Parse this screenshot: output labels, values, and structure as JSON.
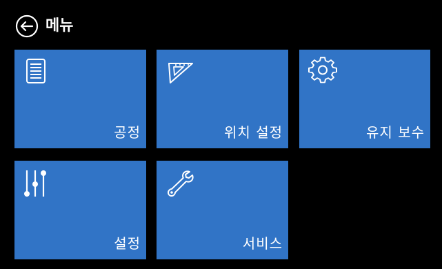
{
  "header": {
    "title": "메뉴",
    "back_icon": "back-arrow-circle-icon"
  },
  "tiles": [
    {
      "label": "공정",
      "icon": "list-document-icon"
    },
    {
      "label": "위치 설정",
      "icon": "set-square-ruler-icon"
    },
    {
      "label": "유지 보수",
      "icon": "gear-icon"
    },
    {
      "label": "설정",
      "icon": "sliders-icon"
    },
    {
      "label": "서비스",
      "icon": "wrench-icon"
    }
  ],
  "colors": {
    "background": "#000000",
    "tile": "#3174c6",
    "text": "#ffffff"
  }
}
